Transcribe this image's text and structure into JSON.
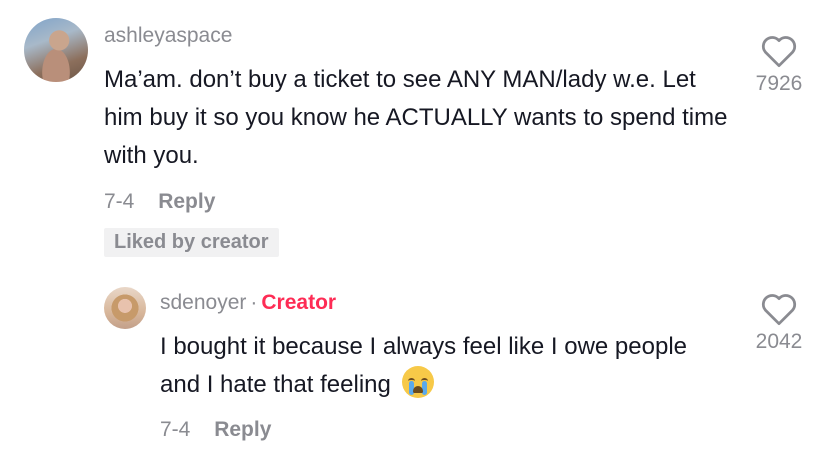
{
  "comments": [
    {
      "username": "ashleyaspace",
      "text": "Ma’am. don’t buy a ticket to see ANY MAN/lady w.e. Let him buy it so you know he ACTUALLY wants to spend time with you.",
      "date": "7-4",
      "reply_label": "Reply",
      "liked_by_creator_label": "Liked by creator",
      "like_count": "7926",
      "heart_icon": "heart-outline-icon"
    }
  ],
  "reply": {
    "username": "sdenoyer",
    "separator": "·",
    "creator_label": "Creator",
    "text": "I bought it because I always feel like I owe people and I hate that feeling",
    "emoji": "loudly-crying-face",
    "date": "7-4",
    "reply_label": "Reply",
    "like_count": "2042",
    "heart_icon": "heart-outline-icon"
  },
  "colors": {
    "accent": "#fe2c55",
    "muted": "#8a8b91",
    "text": "#161823"
  }
}
